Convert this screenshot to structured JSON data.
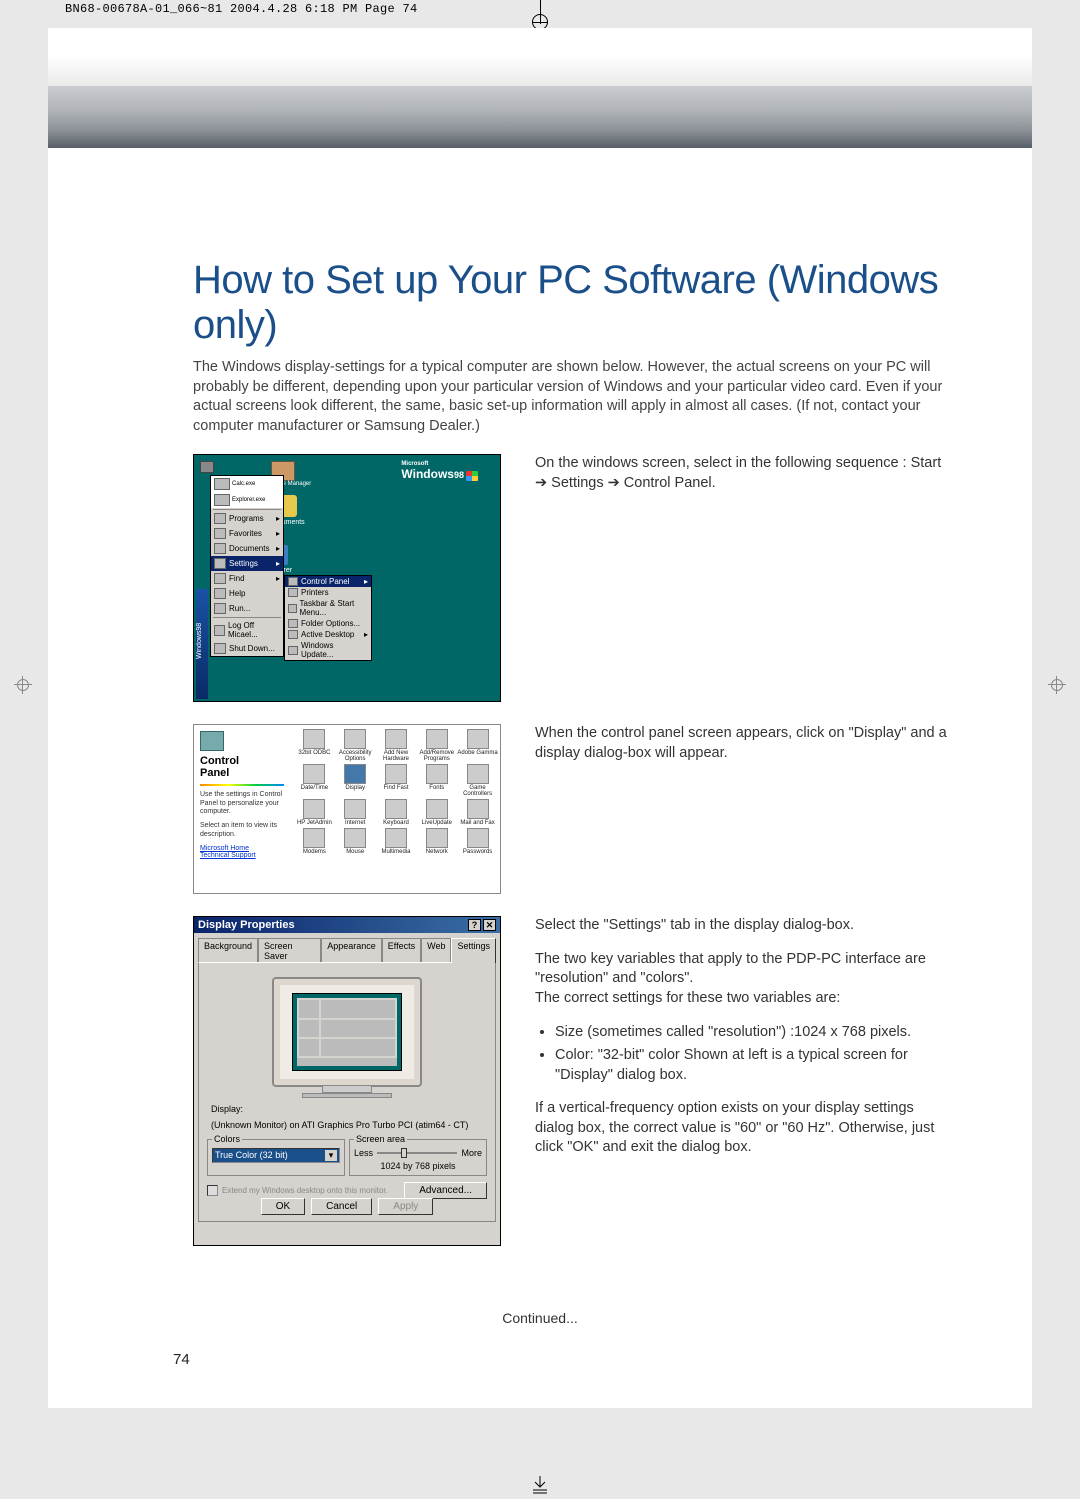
{
  "print_header": "BN68-00678A-01_066~81  2004.4.28  6:18 PM  Page 74",
  "title": "How to Set up Your PC Software (Windows only)",
  "intro": "The Windows display-settings for a typical computer are shown below. However, the actual screens on your PC will probably be different, depending upon your particular version of Windows and your particular video card. Even if your actual screens look different, the same, basic set-up information will apply in almost all cases. (If not, contact your computer manufacturer or Samsung Dealer.)",
  "step1_text": "On the windows screen, select in the following sequence : Start ➔ Settings ➔ Control Panel.",
  "step2_text": "When the control panel screen appears, click on \"Display\" and a display dialog-box will appear.",
  "step3_p1": "Select the \"Settings\" tab in the display dialog-box.",
  "step3_p2": "The two key variables that apply to the PDP-PC interface are \"resolution\" and \"colors\".",
  "step3_p3": "The correct settings for these two variables are:",
  "step3_b1": "Size (sometimes called \"resolution\") :1024 x 768 pixels.",
  "step3_b2": "Color: \"32-bit\" color Shown at left is a typical screen for \"Display\" dialog box.",
  "step3_p4": "If a vertical-frequency option exists on your display settings dialog box, the correct value is \"60\" or \"60 Hz\". Otherwise, just click \"OK\" and exit the dialog box.",
  "continued": "Continued...",
  "page_number": "74",
  "screenshot1": {
    "win_brand_pre": "Microsoft",
    "win_brand": "Windows",
    "win_brand_suf": "98",
    "sidebar": "Windows98",
    "desktop_icons": [
      "Calc.exe",
      "Explorer.exe"
    ],
    "my_documents": "My Documents",
    "explorer": "Explorer",
    "adobe": "Adobe Type Manager",
    "startmenu": {
      "top_big": "",
      "items": [
        {
          "label": "Programs",
          "arrow": "▸"
        },
        {
          "label": "Favorites",
          "arrow": "▸"
        },
        {
          "label": "Documents",
          "arrow": "▸"
        },
        {
          "label": "Settings",
          "arrow": "▸",
          "hl": true
        },
        {
          "label": "Find",
          "arrow": "▸"
        },
        {
          "label": "Help",
          "arrow": ""
        },
        {
          "label": "Run...",
          "arrow": ""
        }
      ],
      "bottom": [
        "Log Off Micael...",
        "Shut Down..."
      ]
    },
    "submenu": [
      {
        "label": "Control Panel",
        "hl": true,
        "arrow": "▸"
      },
      {
        "label": "Printers"
      },
      {
        "label": "Taskbar & Start Menu..."
      },
      {
        "label": "Folder Options..."
      },
      {
        "label": "Active Desktop",
        "arrow": "▸"
      },
      {
        "label": "Windows Update..."
      }
    ]
  },
  "screenshot2": {
    "heading1": "Control",
    "heading2": "Panel",
    "desc": "Use the settings in Control Panel to personalize your computer.",
    "desc2": "Select an item to view its description.",
    "links": [
      "Microsoft Home",
      "Technical Support"
    ],
    "icons": [
      "32bit ODBC",
      "Accessibility Options",
      "Add New Hardware",
      "Add/Remove Programs",
      "Adobe Gamma",
      "Date/Time",
      "Display",
      "Find Fast",
      "Fonts",
      "Game Controllers",
      "HP JetAdmin",
      "Internet",
      "Keyboard",
      "LiveUpdate",
      "Mail and Fax",
      "Modems",
      "Mouse",
      "Multimedia",
      "Network",
      "Passwords"
    ]
  },
  "screenshot3": {
    "title": "Display Properties",
    "close_help": "?",
    "close_x": "✕",
    "tabs": [
      "Background",
      "Screen Saver",
      "Appearance",
      "Effects",
      "Web",
      "Settings"
    ],
    "active_tab": "Settings",
    "display_label": "Display:",
    "display_value": "(Unknown Monitor) on ATI Graphics Pro Turbo PCI (atim64 - CT)",
    "colors_legend": "Colors",
    "colors_value": "True Color (32 bit)",
    "screen_area_legend": "Screen area",
    "less": "Less",
    "more": "More",
    "resolution": "1024 by 768 pixels",
    "extend": "Extend my Windows desktop onto this monitor.",
    "advanced": "Advanced...",
    "ok": "OK",
    "cancel": "Cancel",
    "apply": "Apply"
  }
}
